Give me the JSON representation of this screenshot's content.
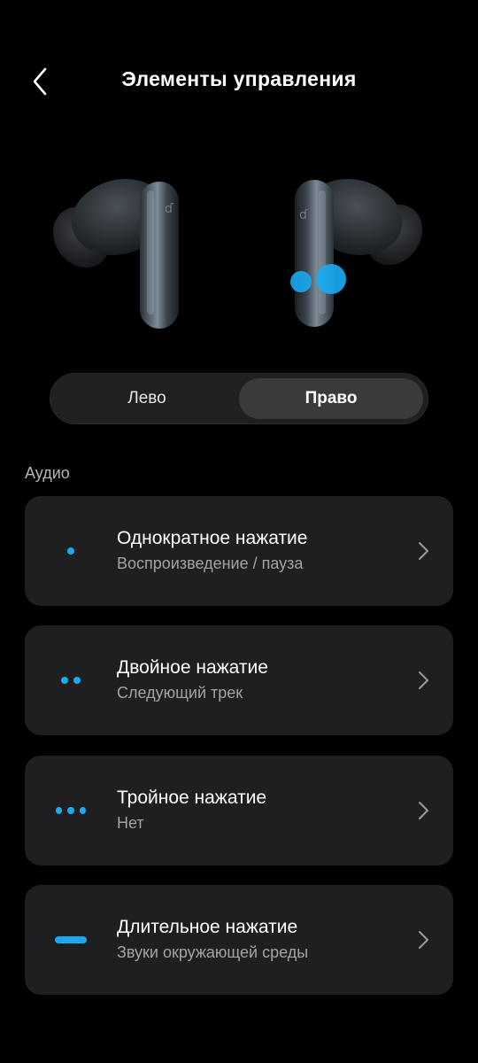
{
  "header": {
    "title": "Элементы управления",
    "back_icon": "chevron-left-icon"
  },
  "earbuds_image": "earbuds-illustration",
  "side_selector": {
    "left_label": "Лево",
    "right_label": "Право",
    "selected": "right"
  },
  "section": {
    "label": "Аудио"
  },
  "controls": [
    {
      "title": "Однократное нажатие",
      "action": "Воспроизведение / пауза",
      "icon": "single-tap-icon"
    },
    {
      "title": "Двойное нажатие",
      "action": "Следующий трек",
      "icon": "double-tap-icon"
    },
    {
      "title": "Тройное нажатие",
      "action": "Нет",
      "icon": "triple-tap-icon"
    },
    {
      "title": "Длительное нажатие",
      "action": "Звуки окружающей среды",
      "icon": "long-press-icon"
    }
  ],
  "colors": {
    "accent": "#1aaaf0",
    "background": "#000000",
    "card": "#1f1f21",
    "selected_segment": "#3a3a3d"
  }
}
